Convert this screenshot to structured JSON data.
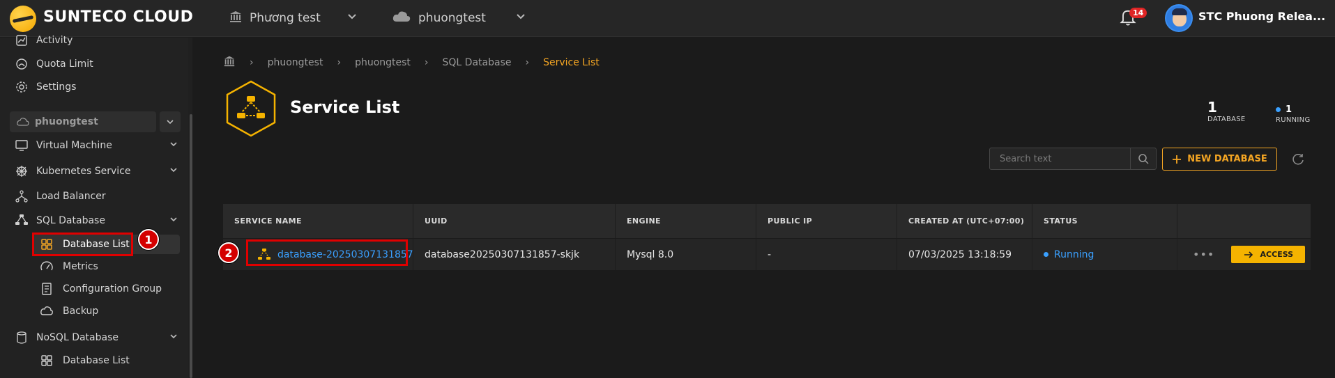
{
  "app": {
    "brand": "SUNTECO CLOUD",
    "org_selector": "Phương test",
    "project_selector": "phuongtest",
    "notifications_count": "14",
    "user_name": "STC Phuong Relea..."
  },
  "sidebar": {
    "top_items": [
      {
        "label": "Activity",
        "icon": "activity-icon"
      },
      {
        "label": "Quota Limit",
        "icon": "quota-icon"
      },
      {
        "label": "Settings",
        "icon": "gear-icon"
      }
    ],
    "project_pill": "phuongtest",
    "sections": [
      {
        "label": "Virtual Machine",
        "icon": "monitor-icon",
        "expandable": true
      },
      {
        "label": "Kubernetes Service",
        "icon": "helm-icon",
        "expandable": true
      },
      {
        "label": "Load Balancer",
        "icon": "load-balancer-icon",
        "expandable": false
      },
      {
        "label": "SQL Database",
        "icon": "sql-database-icon",
        "expandable": true
      }
    ],
    "sql_sub": [
      {
        "label": "Database List",
        "icon": "grid-icon",
        "active": true
      },
      {
        "label": "Metrics",
        "icon": "gauge-icon"
      },
      {
        "label": "Configuration Group",
        "icon": "config-icon"
      },
      {
        "label": "Backup",
        "icon": "backup-icon"
      }
    ],
    "nosql_section": {
      "label": "NoSQL Database",
      "icon": "nosql-icon"
    },
    "nosql_sub": [
      {
        "label": "Database List",
        "icon": "grid-icon"
      }
    ]
  },
  "annotations": {
    "marker1": "1",
    "marker2": "2"
  },
  "breadcrumb": [
    "phuongtest",
    "phuongtest",
    "SQL Database",
    "Service List"
  ],
  "page": {
    "title": "Service List",
    "stats": {
      "database_count": "1",
      "database_label": "DATABASE",
      "running_count": "1",
      "running_label": "RUNNING"
    },
    "search_placeholder": "Search text",
    "new_button": "NEW DATABASE"
  },
  "table": {
    "headers": [
      "SERVICE NAME",
      "UUID",
      "ENGINE",
      "PUBLIC IP",
      "CREATED AT (UTC+07:00)",
      "STATUS",
      ""
    ],
    "rows": [
      {
        "service_name": "database-20250307131857",
        "uuid": "database20250307131857-skjk",
        "engine": "Mysql 8.0",
        "public_ip": "-",
        "created_at": "07/03/2025 13:18:59",
        "status": "Running",
        "more": "•••",
        "action": "ACCESS"
      }
    ]
  },
  "colors": {
    "accent": "#f5a623",
    "link": "#3aa0ff",
    "annotation": "#e00000"
  }
}
